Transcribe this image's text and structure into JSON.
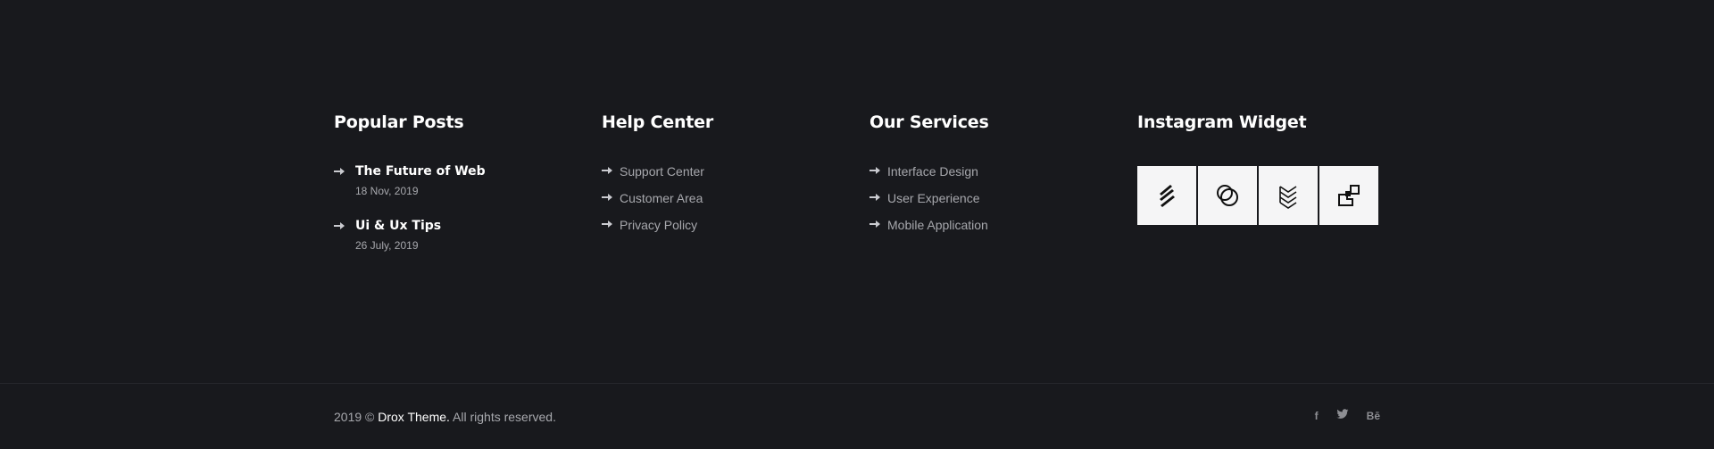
{
  "columns": {
    "popular_posts": {
      "title": "Popular Posts",
      "posts": [
        {
          "title": "The Future of Web",
          "date": "18 Nov, 2019"
        },
        {
          "title": "Ui & Ux Tips",
          "date": "26 July, 2019"
        }
      ]
    },
    "help_center": {
      "title": "Help Center",
      "links": [
        "Support Center",
        "Customer Area",
        "Privacy Policy"
      ]
    },
    "our_services": {
      "title": "Our Services",
      "links": [
        "Interface Design",
        "User Experience",
        "Mobile Application"
      ]
    },
    "instagram": {
      "title": "Instagram Widget",
      "tiles": [
        "slashes-logo-icon",
        "overlapping-circles-logo-icon",
        "chevron-stack-logo-icon",
        "squares-logo-icon"
      ]
    }
  },
  "footer": {
    "copyright_prefix": "2019 © ",
    "brand": "Drox Theme.",
    "copyright_suffix": " All rights reserved.",
    "social": [
      {
        "icon": "facebook-icon",
        "glyph": "f"
      },
      {
        "icon": "twitter-icon",
        "glyph": "🐦"
      },
      {
        "icon": "behance-icon",
        "glyph": "Bē"
      }
    ]
  },
  "colors": {
    "background": "#18191d",
    "heading": "#ffffff",
    "muted_text": "#a7a8ad",
    "tile_background": "#f5f5f6"
  }
}
